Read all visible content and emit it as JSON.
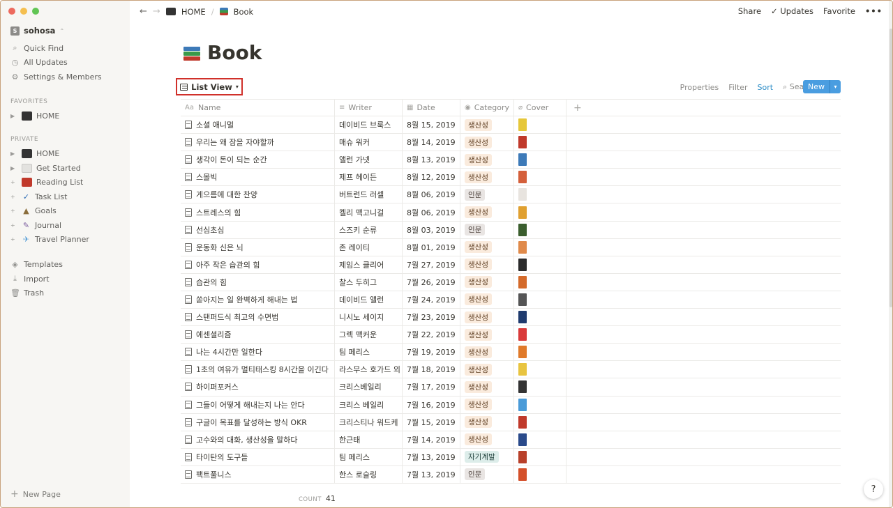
{
  "window": {
    "traffic_lights": [
      "#ed6a5e",
      "#f5bf4f",
      "#61c554"
    ]
  },
  "sidebar": {
    "workspace": {
      "initial": "S",
      "name": "sohosa"
    },
    "top_items": [
      {
        "icon": "search-icon",
        "label": "Quick Find"
      },
      {
        "icon": "clock-icon",
        "label": "All Updates"
      },
      {
        "icon": "gear-icon",
        "label": "Settings & Members"
      }
    ],
    "favorites_heading": "FAVORITES",
    "favorites": [
      {
        "icon": "desktop-icon",
        "label": "HOME"
      }
    ],
    "private_heading": "PRIVATE",
    "private": [
      {
        "icon": "desktop-icon",
        "label": "HOME",
        "color": "#333333"
      },
      {
        "icon": "page-icon",
        "label": "Get Started",
        "color": "#c9c8c5"
      },
      {
        "icon": "book-icon",
        "label": "Reading List",
        "color": "#c0392b"
      },
      {
        "icon": "check-icon",
        "label": "Task List",
        "color": "#2d6cb5"
      },
      {
        "icon": "mountain-icon",
        "label": "Goals",
        "color": "#8a6d3b"
      },
      {
        "icon": "microphone-icon",
        "label": "Journal",
        "color": "#7a5c9e"
      },
      {
        "icon": "airplane-icon",
        "label": "Travel Planner",
        "color": "#5aa0d8"
      }
    ],
    "bottom_items": [
      {
        "icon": "templates-icon",
        "label": "Templates"
      },
      {
        "icon": "import-icon",
        "label": "Import"
      },
      {
        "icon": "trash-icon",
        "label": "Trash"
      }
    ],
    "new_page": "New Page"
  },
  "topbar": {
    "breadcrumb_home": "HOME",
    "breadcrumb_separator": "/",
    "breadcrumb_page": "Book",
    "share": "Share",
    "updates": "Updates",
    "favorite": "Favorite",
    "more": "•••"
  },
  "page": {
    "title": "Book",
    "view_label": "List View",
    "actions": {
      "properties": "Properties",
      "filter": "Filter",
      "sort": "Sort",
      "search": "Search",
      "more": "•••",
      "new": "New"
    }
  },
  "table": {
    "columns": [
      "Name",
      "Writer",
      "Date",
      "Category",
      "Cover"
    ],
    "rows": [
      {
        "name": "소셜 애니멀",
        "writer": "데이비드 브룩스",
        "date": "8월 15, 2019",
        "category": "생산성",
        "cat_type": "productivity",
        "cover_color": "#e6c73a"
      },
      {
        "name": "우리는 왜 잠을 자야할까",
        "writer": "매슈 워커",
        "date": "8월 14, 2019",
        "category": "생산성",
        "cat_type": "productivity",
        "cover_color": "#c0392b"
      },
      {
        "name": "생각이 돈이 되는 순간",
        "writer": "앨런 가넷",
        "date": "8월 13, 2019",
        "category": "생산성",
        "cat_type": "productivity",
        "cover_color": "#3d7ab8"
      },
      {
        "name": "스몰빅",
        "writer": "제프 헤이든",
        "date": "8월 12, 2019",
        "category": "생산성",
        "cat_type": "productivity",
        "cover_color": "#d45f3a"
      },
      {
        "name": "게으름에 대한 찬양",
        "writer": "버트런드 러셀",
        "date": "8월 06, 2019",
        "category": "인문",
        "cat_type": "humanities",
        "cover_color": "#e8e4df"
      },
      {
        "name": "스트레스의 힘",
        "writer": "켈리 맥고니걸",
        "date": "8월 06, 2019",
        "category": "생산성",
        "cat_type": "productivity",
        "cover_color": "#e0a030"
      },
      {
        "name": "선심초심",
        "writer": "스즈키 순류",
        "date": "8월 03, 2019",
        "category": "인문",
        "cat_type": "humanities",
        "cover_color": "#3b5e2e"
      },
      {
        "name": "운동화 신은 뇌",
        "writer": "존 레이티",
        "date": "8월 01, 2019",
        "category": "생산성",
        "cat_type": "productivity",
        "cover_color": "#e08a4a"
      },
      {
        "name": "아주 작은 습관의 힘",
        "writer": "제임스 클리어",
        "date": "7월 27, 2019",
        "category": "생산성",
        "cat_type": "productivity",
        "cover_color": "#2b2b2b"
      },
      {
        "name": "습관의 힘",
        "writer": "찰스 두히그",
        "date": "7월 26, 2019",
        "category": "생산성",
        "cat_type": "productivity",
        "cover_color": "#d46a2a"
      },
      {
        "name": "쏟아지는 일 완벽하게 해내는 법",
        "writer": "데이비드 앨런",
        "date": "7월 24, 2019",
        "category": "생산성",
        "cat_type": "productivity",
        "cover_color": "#555555"
      },
      {
        "name": "스탠퍼드식 최고의 수면법",
        "writer": "니시노 세이지",
        "date": "7월 23, 2019",
        "category": "생산성",
        "cat_type": "productivity",
        "cover_color": "#1f3b6e"
      },
      {
        "name": "에센셜리즘",
        "writer": "그렉 맥커운",
        "date": "7월 22, 2019",
        "category": "생산성",
        "cat_type": "productivity",
        "cover_color": "#d93a3a"
      },
      {
        "name": "나는 4시간만 일한다",
        "writer": "팀 페리스",
        "date": "7월 19, 2019",
        "category": "생산성",
        "cat_type": "productivity",
        "cover_color": "#e07a2a"
      },
      {
        "name": "1초의 여유가 멀티태스킹 8시간을 이긴다",
        "writer": "라스무스 호가드 외",
        "date": "7월 18, 2019",
        "category": "생산성",
        "cat_type": "productivity",
        "cover_color": "#e8c440"
      },
      {
        "name": "하이퍼포커스",
        "writer": "크리스베일리",
        "date": "7월 17, 2019",
        "category": "생산성",
        "cat_type": "productivity",
        "cover_color": "#333333"
      },
      {
        "name": "그들이 어떻게 해내는지 나는 안다",
        "writer": "크리스 베일리",
        "date": "7월 16, 2019",
        "category": "생산성",
        "cat_type": "productivity",
        "cover_color": "#4a9bd8"
      },
      {
        "name": "구글이 목표를 달성하는 방식 OKR",
        "writer": "크리스티나 워드케",
        "date": "7월 15, 2019",
        "category": "생산성",
        "cat_type": "productivity",
        "cover_color": "#c0392b"
      },
      {
        "name": "고수와의 대화, 생산성을 말하다",
        "writer": "한근태",
        "date": "7월 14, 2019",
        "category": "생산성",
        "cat_type": "productivity",
        "cover_color": "#2a4a8a"
      },
      {
        "name": "타이탄의 도구들",
        "writer": "팀 페리스",
        "date": "7월 13, 2019",
        "category": "자기계발",
        "cat_type": "selfdev",
        "cover_color": "#b8402a"
      },
      {
        "name": "팩트풀니스",
        "writer": "한스 로슬링",
        "date": "7월 13, 2019",
        "category": "인문",
        "cat_type": "humanities",
        "cover_color": "#d4502a"
      }
    ]
  },
  "footer": {
    "count_label": "COUNT",
    "count_value": "41"
  },
  "help": "?"
}
